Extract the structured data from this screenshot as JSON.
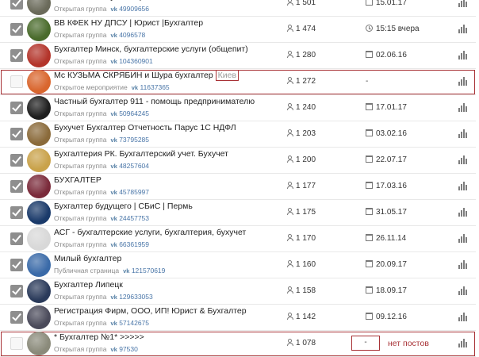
{
  "colors": {
    "highlight": "#a83236",
    "link": "#4a76a8",
    "checkbox_checked": "#8e8e8e"
  },
  "rows": [
    {
      "checked": true,
      "highlight": false,
      "avatar": "#6a6a5a",
      "name": "Ваш Личный Бухгалтер",
      "type": "Открытая группа",
      "vk": "vk",
      "id": "49909656",
      "members": "1 501",
      "date_icon": "calendar-icon",
      "date": "15.01.17"
    },
    {
      "checked": true,
      "highlight": false,
      "avatar": "#4a6b2c",
      "name": "ВВ КФЕК НУ ДПСУ | Юрист |Бухгалтер",
      "type": "Открытая группа",
      "vk": "vk",
      "id": "4096578",
      "members": "1 474",
      "date_icon": "clock-icon",
      "date": "15:15 вчера"
    },
    {
      "checked": true,
      "highlight": false,
      "avatar": "#b3342a",
      "name": "Бухгалтер Минск, бухгалтерские услуги (общепит)",
      "type": "Открытая группа",
      "vk": "vk",
      "id": "104360901",
      "members": "1 280",
      "date_icon": "calendar-icon",
      "date": "02.06.16"
    },
    {
      "checked": false,
      "highlight": true,
      "avatar": "#d9662e",
      "name": "Мс КУЗЬМА СКРЯБИН и Шура бухгалтер",
      "name_tag": "Киев",
      "type": "Открытое мероприятие",
      "vk": "vk",
      "id": "11637365",
      "members": "1 272",
      "date_icon": "",
      "date": "-"
    },
    {
      "checked": true,
      "highlight": false,
      "avatar": "#1e1e1e",
      "name": "Частный бухгалтер 911 - помощь предпринимателю",
      "type": "Открытая группа",
      "vk": "vk",
      "id": "50964245",
      "members": "1 240",
      "date_icon": "calendar-icon",
      "date": "17.01.17"
    },
    {
      "checked": true,
      "highlight": false,
      "avatar": "#8a6a3a",
      "name": "Бухучет Бухгалтер Отчетность Парус 1С НДФЛ",
      "type": "Открытая группа",
      "vk": "vk",
      "id": "73795285",
      "members": "1 203",
      "date_icon": "calendar-icon",
      "date": "03.02.16"
    },
    {
      "checked": true,
      "highlight": false,
      "avatar": "#c9a24a",
      "name": "Бухгалтерия РК. Бухгалтерский учет. Бухучет",
      "type": "Открытая группа",
      "vk": "vk",
      "id": "48257604",
      "members": "1 200",
      "date_icon": "calendar-icon",
      "date": "22.07.17"
    },
    {
      "checked": true,
      "highlight": false,
      "avatar": "#7a2a3a",
      "name": "БУХГАЛТЕР",
      "type": "Открытая группа",
      "vk": "vk",
      "id": "45785997",
      "members": "1 177",
      "date_icon": "calendar-icon",
      "date": "17.03.16"
    },
    {
      "checked": true,
      "highlight": false,
      "avatar": "#1a3a6a",
      "name": "Бухгалтер будущего | СБиС | Пермь",
      "type": "Открытая группа",
      "vk": "vk",
      "id": "24457753",
      "members": "1 175",
      "date_icon": "calendar-icon",
      "date": "31.05.17"
    },
    {
      "checked": true,
      "highlight": false,
      "avatar": "#d8d8d8",
      "name": "АСГ - бухгалтерские услуги, бухгалтерия, бухучет",
      "type": "Открытая группа",
      "vk": "vk",
      "id": "66361959",
      "members": "1 170",
      "date_icon": "calendar-icon",
      "date": "26.11.14"
    },
    {
      "checked": true,
      "highlight": false,
      "avatar": "#3a6aa8",
      "name": "Милый бухгалтер",
      "type": "Публичная страница",
      "vk": "vk",
      "id": "121570619",
      "members": "1 160",
      "date_icon": "calendar-icon",
      "date": "20.09.17"
    },
    {
      "checked": true,
      "highlight": false,
      "avatar": "#2a3a5a",
      "name": "Бухгалтер Липецк",
      "type": "Открытая группа",
      "vk": "vk",
      "id": "129633053",
      "members": "1 158",
      "date_icon": "calendar-icon",
      "date": "18.09.17"
    },
    {
      "checked": true,
      "highlight": false,
      "avatar": "#4a4a5a",
      "name": "Регистрация Фирм, ООО, ИП! Юрист & Бухгалтер",
      "type": "Открытая группа",
      "vk": "vk",
      "id": "57142675",
      "members": "1 142",
      "date_icon": "calendar-icon",
      "date": "09.12.16"
    },
    {
      "checked": false,
      "highlight": true,
      "avatar": "#8a8a7a",
      "name": "* Бухгалтер №1* >>>>>",
      "type": "Открытая группа",
      "vk": "vk",
      "id": "97530",
      "members": "1 078",
      "date_icon": "",
      "date": "-",
      "note": "нет постов"
    }
  ]
}
